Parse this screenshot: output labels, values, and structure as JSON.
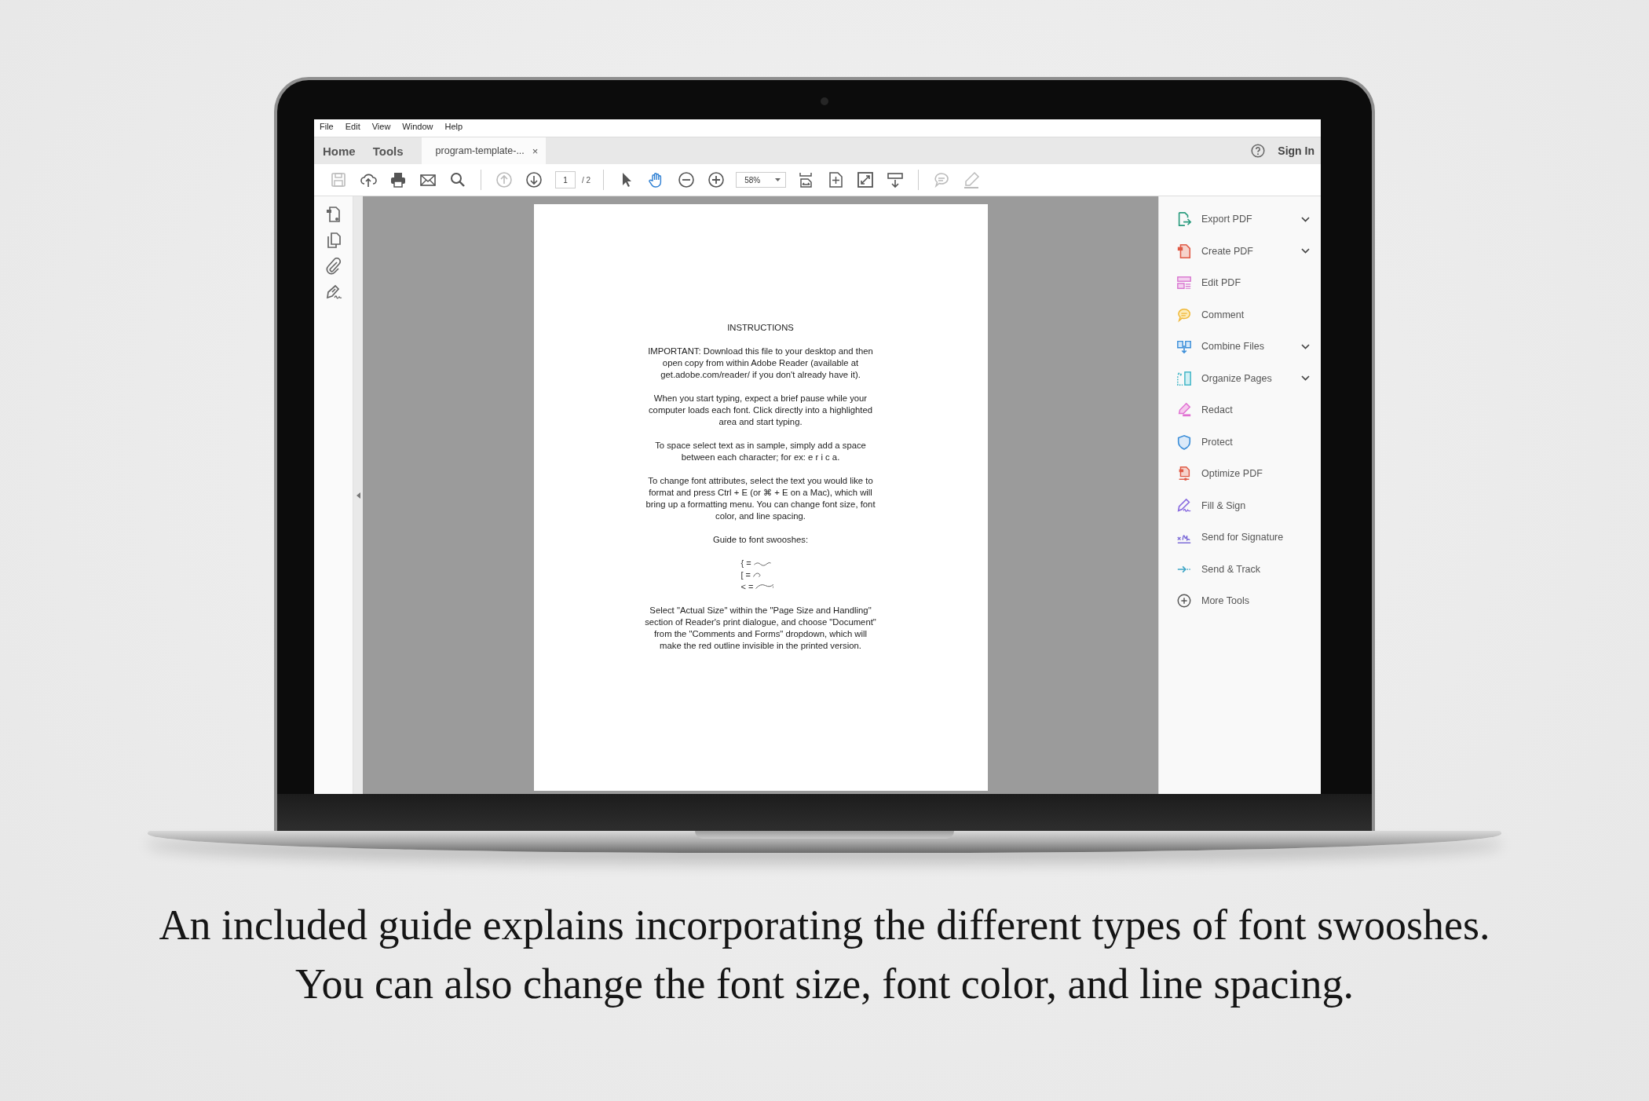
{
  "menu": [
    "File",
    "Edit",
    "View",
    "Window",
    "Help"
  ],
  "tabs": [
    {
      "label": "Home",
      "selected": false
    },
    {
      "label": "Tools",
      "selected": false
    },
    {
      "label": "program-template-...",
      "selected": true,
      "close": "×"
    }
  ],
  "sign_in": "Sign In",
  "toolbar": {
    "tools": [
      {
        "kind": "save",
        "disabled": true,
        "selected": false
      },
      {
        "kind": "upload",
        "disabled": false,
        "selected": false
      },
      {
        "kind": "print",
        "disabled": false,
        "selected": false
      },
      {
        "kind": "email",
        "disabled": false,
        "selected": false
      },
      {
        "kind": "search",
        "disabled": false,
        "selected": false
      },
      {
        "kind": "sep"
      },
      {
        "kind": "prev",
        "disabled": true,
        "selected": false
      },
      {
        "kind": "next",
        "disabled": false,
        "selected": false
      },
      {
        "kind": "page",
        "value": "1",
        "total": "/ 2"
      },
      {
        "kind": "sep"
      },
      {
        "kind": "cursor",
        "disabled": false,
        "selected": false
      },
      {
        "kind": "hand",
        "disabled": false,
        "selected": true
      },
      {
        "kind": "zoomout",
        "disabled": false,
        "selected": false
      },
      {
        "kind": "zoomin",
        "disabled": false,
        "selected": false
      },
      {
        "kind": "zoom",
        "value": "58%"
      },
      {
        "kind": "fitwidth",
        "disabled": false,
        "selected": false
      },
      {
        "kind": "fitpage",
        "disabled": false,
        "selected": false
      },
      {
        "kind": "fullscreen",
        "disabled": false,
        "selected": false
      },
      {
        "kind": "scroll",
        "disabled": false,
        "selected": false
      },
      {
        "kind": "sep"
      },
      {
        "kind": "comment",
        "disabled": true,
        "selected": false
      },
      {
        "kind": "highlight",
        "disabled": true,
        "selected": false
      }
    ]
  },
  "left_rail": [
    {
      "kind": "pages"
    },
    {
      "kind": "copy"
    },
    {
      "kind": "attach"
    },
    {
      "kind": "sign"
    }
  ],
  "document": {
    "title": "INSTRUCTIONS",
    "paragraphs": [
      "IMPORTANT:  Download this file to your desktop and then open copy from within Adobe Reader (available at get.adobe.com/reader/ if you don't already have it).",
      "When you start typing, expect a brief pause while your computer loads each font. Click directly into a highlighted area and start typing.",
      "To space select text as in sample, simply add a space between each character; for ex: e r i c a.",
      "To change font attributes, select the text you would like to format and press Ctrl + E (or ⌘ + E on a Mac), which will bring up a formatting menu. You can change font size, font color, and line spacing.",
      "Guide to font swooshes:"
    ],
    "swooshes": [
      {
        "key": "{ =",
        "kind": "wave"
      },
      {
        "key": "[ =",
        "kind": "hook"
      },
      {
        "key": "< =",
        "kind": "long"
      }
    ],
    "footer": "Select \"Actual Size\" within the \"Page Size and Handling\" section of Reader's print dialogue, and choose \"Document\" from the \"Comments and Forms\" dropdown, which will make the red outline invisible in the printed version."
  },
  "tools_panel": [
    {
      "kind": "export",
      "label": "Export PDF",
      "has_menu": true
    },
    {
      "kind": "create",
      "label": "Create PDF",
      "has_menu": true
    },
    {
      "kind": "edit",
      "label": "Edit PDF",
      "has_menu": false
    },
    {
      "kind": "comment",
      "label": "Comment",
      "has_menu": false
    },
    {
      "kind": "combine",
      "label": "Combine Files",
      "has_menu": true
    },
    {
      "kind": "organize",
      "label": "Organize Pages",
      "has_menu": true
    },
    {
      "kind": "redact",
      "label": "Redact",
      "has_menu": false
    },
    {
      "kind": "protect",
      "label": "Protect",
      "has_menu": false
    },
    {
      "kind": "optimize",
      "label": "Optimize PDF",
      "has_menu": false
    },
    {
      "kind": "fillsign",
      "label": "Fill & Sign",
      "has_menu": false
    },
    {
      "kind": "sendsig",
      "label": "Send for Signature",
      "has_menu": false
    },
    {
      "kind": "sendtrack",
      "label": "Send & Track",
      "has_menu": false
    },
    {
      "kind": "more",
      "label": "More Tools",
      "has_menu": false
    }
  ],
  "caption": [
    "An included guide explains incorporating the different types of font swooshes.",
    "You can also change the font size, font color, and line spacing."
  ]
}
